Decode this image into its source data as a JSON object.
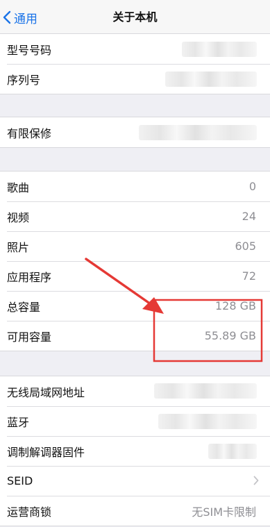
{
  "nav": {
    "back_label": "通用",
    "title": "关于本机"
  },
  "group1": [
    {
      "label": "型号号码",
      "value": ""
    },
    {
      "label": "序列号",
      "value": ""
    }
  ],
  "group2": [
    {
      "label": "有限保修",
      "value": ""
    }
  ],
  "group3": [
    {
      "label": "歌曲",
      "value": "0"
    },
    {
      "label": "视频",
      "value": "24"
    },
    {
      "label": "照片",
      "value": "605"
    },
    {
      "label": "应用程序",
      "value": "72"
    },
    {
      "label": "总容量",
      "value": "128 GB"
    },
    {
      "label": "可用容量",
      "value": "55.89 GB"
    }
  ],
  "group4": [
    {
      "label": "无线局域网地址",
      "value": ""
    },
    {
      "label": "蓝牙",
      "value": ""
    },
    {
      "label": "调制解调器固件",
      "value": ""
    },
    {
      "label": "SEID",
      "value": ""
    },
    {
      "label": "运营商锁",
      "value": "无SIM卡限制"
    }
  ],
  "colors": {
    "accent": "#1a73e8",
    "annotation": "#e53935"
  }
}
